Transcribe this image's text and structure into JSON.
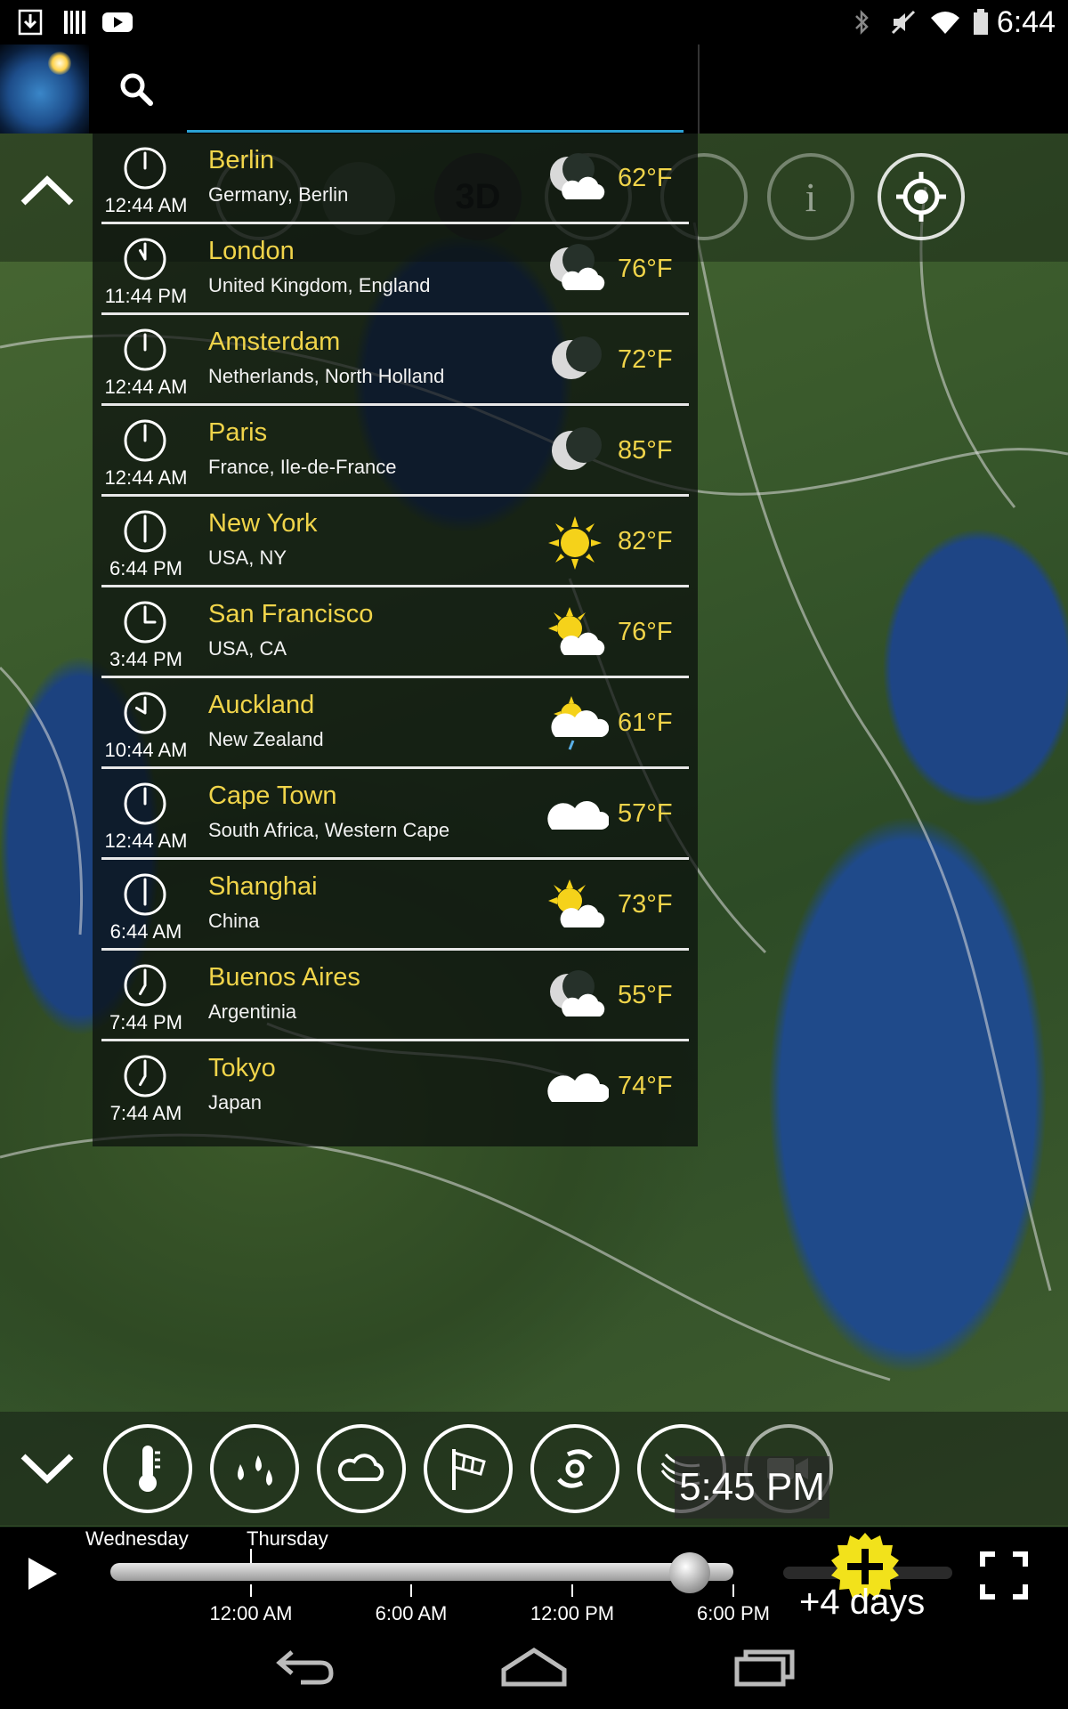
{
  "status_bar": {
    "time": "6:44"
  },
  "search": {
    "placeholder": "",
    "value": ""
  },
  "cities": [
    {
      "name": "Berlin",
      "region": "Germany, Berlin",
      "local_time": "12:44 AM",
      "temp": "62°F",
      "weather_icon": "moon-cloud-icon"
    },
    {
      "name": "London",
      "region": "United Kingdom, England",
      "local_time": "11:44 PM",
      "temp": "76°F",
      "weather_icon": "moon-cloud-icon"
    },
    {
      "name": "Amsterdam",
      "region": "Netherlands, North Holland",
      "local_time": "12:44 AM",
      "temp": "72°F",
      "weather_icon": "moon-icon"
    },
    {
      "name": "Paris",
      "region": "France, Ile-de-France",
      "local_time": "12:44 AM",
      "temp": "85°F",
      "weather_icon": "moon-icon"
    },
    {
      "name": "New York",
      "region": "USA, NY",
      "local_time": "6:44 PM",
      "temp": "82°F",
      "weather_icon": "sun-icon"
    },
    {
      "name": "San Francisco",
      "region": "USA, CA",
      "local_time": "3:44 PM",
      "temp": "76°F",
      "weather_icon": "sun-cloud-icon"
    },
    {
      "name": "Auckland",
      "region": "New Zealand",
      "local_time": "10:44 AM",
      "temp": "61°F",
      "weather_icon": "sun-rain-icon"
    },
    {
      "name": "Cape Town",
      "region": "South Africa, Western Cape",
      "local_time": "12:44 AM",
      "temp": "57°F",
      "weather_icon": "cloud-icon"
    },
    {
      "name": "Shanghai",
      "region": "China",
      "local_time": "6:44 AM",
      "temp": "73°F",
      "weather_icon": "sun-cloud-icon"
    },
    {
      "name": "Buenos Aires",
      "region": "Argentinia",
      "local_time": "7:44 PM",
      "temp": "55°F",
      "weather_icon": "moon-cloud-icon"
    },
    {
      "name": "Tokyo",
      "region": "Japan",
      "local_time": "7:44 AM",
      "temp": "74°F",
      "weather_icon": "cloud-icon"
    }
  ],
  "top_toolbar": {
    "btn_3d_label": "3D"
  },
  "overlay_time": "5:45 PM",
  "timeline": {
    "days": [
      "Wednesday",
      "Thursday"
    ],
    "ticks": [
      "12:00 AM",
      "6:00 AM",
      "12:00 PM",
      "6:00 PM"
    ],
    "forecast_label": "+4 days",
    "progress": 0.93
  },
  "colors": {
    "accent_yellow": "#f0d44a",
    "search_underline": "#2aa1d4"
  }
}
